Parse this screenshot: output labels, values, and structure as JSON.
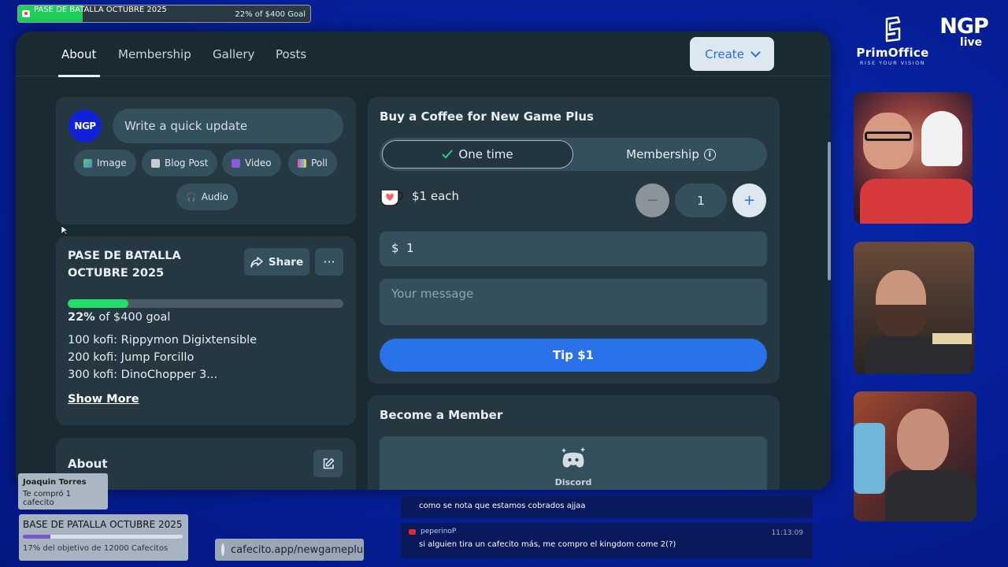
{
  "overlay_goal": {
    "title": "PASE DE BATALLA OCTUBRE 2025",
    "progress_text": "22% of $400 Goal"
  },
  "tabs": [
    "About",
    "Membership",
    "Gallery",
    "Posts"
  ],
  "create_label": "Create",
  "quick_update": {
    "avatar_text": "NGP",
    "placeholder": "Write a quick update",
    "chips": [
      "Image",
      "Blog Post",
      "Video",
      "Poll",
      "Audio"
    ]
  },
  "battle_pass": {
    "title": "PASE DE BATALLA OCTUBRE 2025",
    "share_label": "Share",
    "more_label": "···",
    "percent": "22%",
    "goal_text": "of $400 goal",
    "rewards": [
      "100 kofi: Rippymon Digixtensible",
      "200 kofi: Jump Forcillo",
      "300 kofi: DinoChopper 3..."
    ],
    "show_more": "Show More"
  },
  "about_card": {
    "title": "About"
  },
  "coffee": {
    "title": "Buy a Coffee for New Game Plus",
    "option_one_time": "One time",
    "option_membership": "Membership",
    "price_each": "$1 each",
    "quantity": "1",
    "minus": "−",
    "plus": "+",
    "amount_currency": "$",
    "amount_value": "1",
    "message_placeholder": "Your message",
    "tip_label": "Tip $1"
  },
  "member": {
    "title": "Become a Member",
    "discord_label": "Discord"
  },
  "brand": {
    "prim_name": "PrimOffice",
    "prim_tag": "RISE YOUR VISION",
    "ngp_top": "NGP",
    "ngp_bottom": "live"
  },
  "alert": {
    "name": "Joaquin Torres",
    "message": "Te compró 1 cafecito"
  },
  "cafecito_goal": {
    "title": "BASE DE PATALLA OCTUBRE 2025",
    "progress": 0.17,
    "subtitle": "17% del objetivo de 12000 Cafecitos"
  },
  "url": "cafecito.app/newgameplus",
  "chat": {
    "line1": "como se nota que estamos cobrados ajjaa",
    "user2": "peperinoP",
    "time2": "11:13:09",
    "line2": "si alguien tira un cafecito más, me compro el kingdom come 2(?)"
  }
}
